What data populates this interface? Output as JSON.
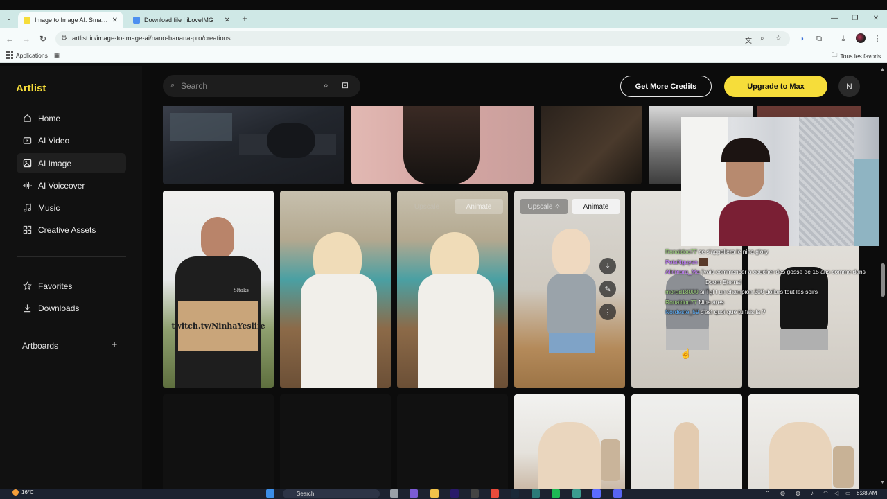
{
  "browser": {
    "tabs": [
      {
        "title": "Image to Image AI: Smart AI Ima",
        "active": true
      },
      {
        "title": "Download file | iLoveIMG",
        "active": false
      }
    ],
    "url": "artlist.io/image-to-image-ai/nano-banana-pro/creations",
    "bookmarks": {
      "apps_label": "Applications",
      "all_bookmarks_label": "Tous les favoris"
    }
  },
  "app": {
    "logo": "Artlist",
    "nav": [
      {
        "label": "Home",
        "icon": "home-icon"
      },
      {
        "label": "AI Video",
        "icon": "video-icon"
      },
      {
        "label": "AI Image",
        "icon": "image-icon",
        "active": true
      },
      {
        "label": "AI Voiceover",
        "icon": "waveform-icon"
      },
      {
        "label": "Music",
        "icon": "music-note-icon"
      },
      {
        "label": "Creative Assets",
        "icon": "grid-icon"
      }
    ],
    "nav_secondary": [
      {
        "label": "Favorites",
        "icon": "star-icon"
      },
      {
        "label": "Downloads",
        "icon": "download-icon"
      }
    ],
    "artboards_label": "Artboards",
    "search_placeholder": "Search",
    "get_credits_label": "Get More Credits",
    "upgrade_label": "Upgrade to Max",
    "user_initial": "N",
    "tile_actions": {
      "upscale": "Upscale",
      "animate": "Animate"
    },
    "accent_color": "#f6dd3a",
    "sign_text": "twitch.tv/NinhaYeslife",
    "shirt_text": "Sltaks"
  },
  "stream": {
    "chat": [
      {
        "user": "Ronaldoo77",
        "msg": "ce s'appellera le nina glory",
        "color": "#9fd47f"
      },
      {
        "user": "PetaNguyen",
        "msg": "",
        "color": "#c37cff"
      },
      {
        "user": "Alkimara_Ma",
        "msg": "j'vais commencer a coucher des gosse de 15 ans comme dans",
        "color": "#c37cff"
      },
      {
        "user": "",
        "msg": "Doom Eternal",
        "color": "#c37cff"
      },
      {
        "user": "morad18000",
        "msg": "si Tgl t un champion 200 dollars tout les soirs",
        "color": "#9fd47f"
      },
      {
        "user": "Ronaldoo77",
        "msg": "Nina ares",
        "color": "#9fd47f"
      },
      {
        "user": "Nordeste_59",
        "msg": "c'est quoi que tu fais la ?",
        "color": "#5fb3ff"
      }
    ]
  },
  "taskbar": {
    "weather": "16°C",
    "search_label": "Search",
    "clock": "8:38 AM"
  }
}
